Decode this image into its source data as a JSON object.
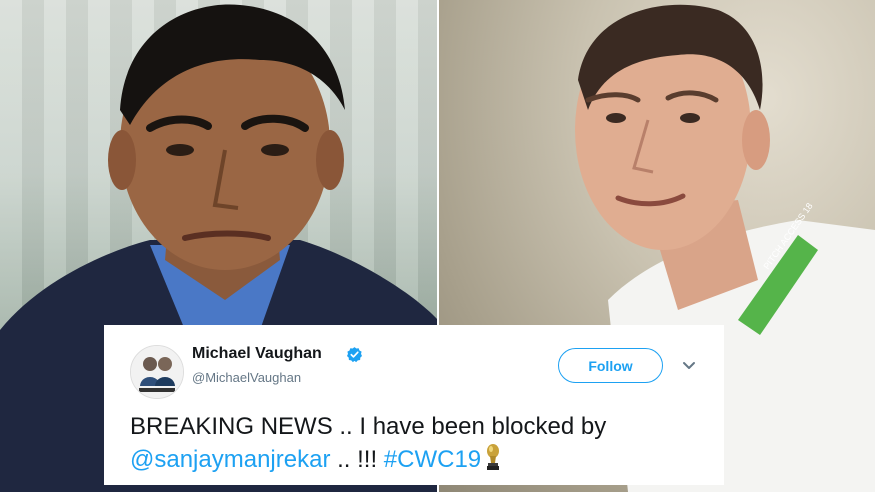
{
  "tweet": {
    "display_name": "Michael Vaughan",
    "handle": "@MichaelVaughan",
    "follow_label": "Follow",
    "text_line1": "BREAKING NEWS .. I have been blocked by",
    "mention": "@sanjaymanjrekar",
    "separator": " .. !!! ",
    "hashtag": "#CWC19"
  },
  "colors": {
    "accent": "#1da1f2",
    "text": "#14171a",
    "muted": "#657786"
  }
}
